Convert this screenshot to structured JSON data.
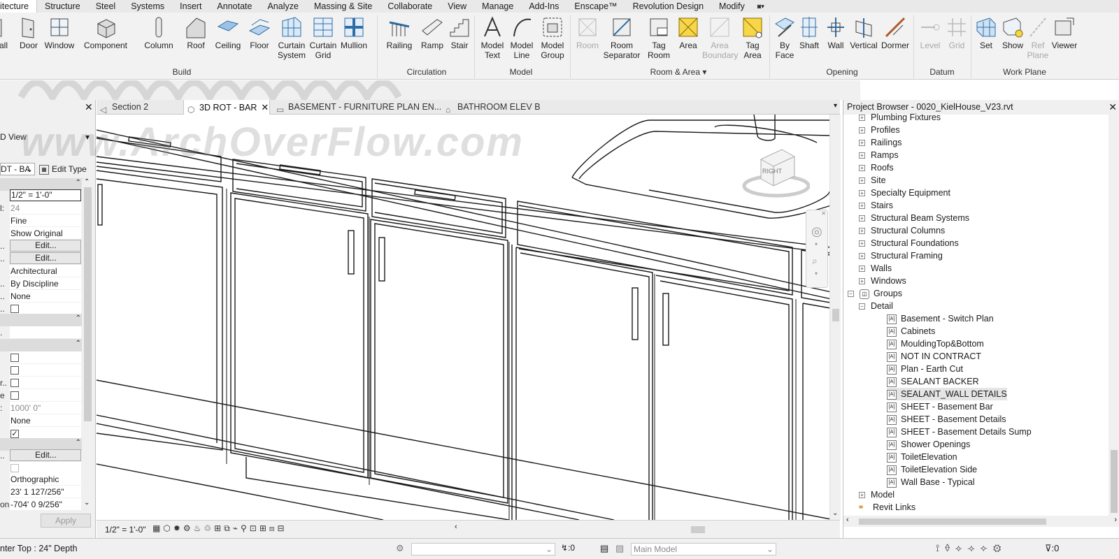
{
  "menu": [
    "itecture",
    "Structure",
    "Steel",
    "Systems",
    "Insert",
    "Annotate",
    "Analyze",
    "Massing & Site",
    "Collaborate",
    "View",
    "Manage",
    "Add-Ins",
    "Enscape™",
    "Revolution Design",
    "Modify"
  ],
  "ribbon": {
    "build": {
      "title": "Build",
      "buttons": [
        "all",
        "Door",
        "Window",
        "Component",
        "Column",
        "Roof",
        "Ceiling",
        "Floor",
        "Curtain System",
        "Curtain Grid",
        "Mullion"
      ]
    },
    "circulation": {
      "title": "Circulation",
      "buttons": [
        "Railing",
        "Ramp",
        "Stair"
      ]
    },
    "model": {
      "title": "Model",
      "buttons": [
        "Model Text",
        "Model Line",
        "Model Group"
      ]
    },
    "room_area": {
      "title": "Room & Area",
      "buttons": [
        "Room",
        "Room Separator",
        "Tag Room",
        "Area",
        "Area Boundary",
        "Tag Area"
      ]
    },
    "opening": {
      "title": "Opening",
      "buttons": [
        "By Face",
        "Shaft",
        "Wall",
        "Vertical",
        "Dormer"
      ]
    },
    "datum": {
      "title": "Datum",
      "buttons": [
        "Level",
        "Grid"
      ]
    },
    "work_plane": {
      "title": "Work Plane",
      "buttons": [
        "Set",
        "Show",
        "Ref Plane",
        "Viewer"
      ]
    }
  },
  "watermark": "www.ArchOverFlow.com",
  "properties": {
    "type_label": "D View",
    "type_selector": "DT - BA",
    "edit_type": "Edit Type",
    "rows": [
      {
        "k": "",
        "v": "1/2\" = 1'-0\"",
        "style": "boxed"
      },
      {
        "k": "l:",
        "v": "24",
        "style": "gray"
      },
      {
        "k": "",
        "v": "Fine",
        "style": ""
      },
      {
        "k": "",
        "v": "Show Original",
        "style": ""
      },
      {
        "k": "..",
        "v": "Edit...",
        "style": "btn"
      },
      {
        "k": "..",
        "v": "Edit...",
        "style": "btn"
      },
      {
        "k": "",
        "v": "Architectural",
        "style": ""
      },
      {
        "k": "..",
        "v": "By Discipline",
        "style": ""
      },
      {
        "k": "..",
        "v": "None",
        "style": ""
      }
    ],
    "extent_far_clip": "1000' 0\"",
    "none2": "None",
    "edit3": "Edit...",
    "projection": "Orthographic",
    "eye_elev": "23' 1 127/256\"",
    "target_label": "on",
    "target_elev": "-704' 0 9/256\"",
    "apply": "Apply"
  },
  "tabs": [
    {
      "label": "Section 2",
      "active": false
    },
    {
      "label": "3D ROT - BAR",
      "active": true
    },
    {
      "label": "BASEMENT - FURNITURE PLAN EN...",
      "active": false
    },
    {
      "label": "BATHROOM ELEV B",
      "active": false
    }
  ],
  "view_scale": "1/2\" = 1'-0\"",
  "viewcube_face": "RIGHT",
  "project_browser": {
    "title": "Project Browser - 0020_KielHouse_V23.rvt",
    "families": [
      "Plumbing Fixtures",
      "Profiles",
      "Railings",
      "Ramps",
      "Roofs",
      "Site",
      "Specialty Equipment",
      "Stairs",
      "Structural Beam Systems",
      "Structural Columns",
      "Structural Foundations",
      "Structural Framing",
      "Walls",
      "Windows"
    ],
    "groups_label": "Groups",
    "detail_label": "Detail",
    "detail_groups": [
      "Basement - Switch Plan",
      "Cabinets",
      "MouldingTop&Bottom",
      "NOT IN CONTRACT",
      "Plan - Earth Cut",
      "SEALANT BACKER",
      "SEALANT_WALL DETAILS",
      "SHEET - Basement Bar",
      "SHEET - Basement Details",
      "SHEET - Basement Details Sump",
      "Shower Openings",
      "ToiletElevation",
      "ToiletElevation Side",
      "Wall Base - Typical"
    ],
    "selected": "SEALANT_WALL DETAILS",
    "model_label": "Model",
    "revit_links": "Revit Links"
  },
  "status": {
    "text": "nter Top : 24\" Depth",
    "sel_count": ":0",
    "workset": "Main Model",
    "filter_count": ":0"
  }
}
